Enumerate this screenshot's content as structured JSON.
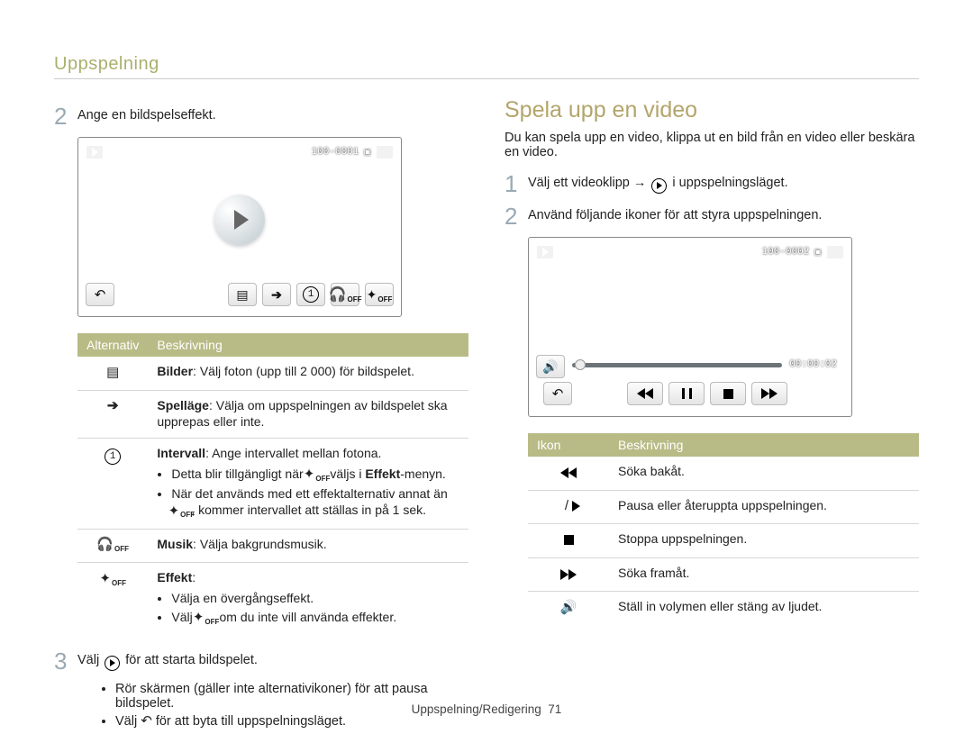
{
  "doc": {
    "header": "Uppspelning",
    "footer_label": "Uppspelning/Redigering",
    "footer_page": "71"
  },
  "left": {
    "steps": {
      "s2": {
        "num": "2",
        "text": "Ange en bildspelseffekt."
      },
      "s3": {
        "num": "3",
        "prefix": "Välj ",
        "suffix": " för att starta bildspelet.",
        "bullets": [
          "Rör skärmen (gäller inte alternativikoner) för att pausa bildspelet.",
          {
            "pre": "Välj ",
            "icon": "↶",
            "post": " för att byta till uppspelningsläget."
          }
        ]
      }
    },
    "screen": {
      "corner_id": "100-0001",
      "icons": {
        "back": "↶",
        "images": "images-icon",
        "arrow": "➔",
        "interval": "1",
        "music_off": "OFF",
        "effect_off": "OFF"
      }
    },
    "table": {
      "headers": {
        "c1": "Alternativ",
        "c2": "Beskrivning"
      },
      "rows": {
        "images": {
          "b": "Bilder",
          "rest": ": Välj foton (upp till 2 000) för bildspelet."
        },
        "playmode": {
          "b": "Spelläge",
          "rest": ": Välja om uppspelningen av bildspelet ska upprepas eller inte."
        },
        "interval": {
          "b": "Intervall",
          "rest": ": Ange intervallet mellan fotona.",
          "b1": {
            "pre": "Detta blir tillgängligt när ",
            "mid": " väljs i ",
            "bold": "Effekt",
            "post": "-menyn."
          },
          "b2": {
            "pre": "När det används med ett effektalternativ annat än ",
            "post": ", kommer intervallet att ställas in på 1 sek."
          }
        },
        "music": {
          "b": "Musik",
          "rest": ": Välja bakgrundsmusik."
        },
        "effect": {
          "b": "Effekt",
          "rest": ":",
          "b1": "Välja en övergångseffekt.",
          "b2": {
            "pre": "Välj ",
            "post": " om du inte vill använda effekter."
          }
        }
      }
    }
  },
  "right": {
    "title": "Spela upp en video",
    "intro": "Du kan spela upp en video, klippa ut en bild från en video eller beskära en video.",
    "steps": {
      "s1": {
        "num": "1",
        "pre": "Välj ett videoklipp → ",
        "post": " i uppspelningsläget."
      },
      "s2": {
        "num": "2",
        "text": "Använd följande ikoner för att styra uppspelningen."
      }
    },
    "screen": {
      "corner_id": "100-0002",
      "time": "00:00:02"
    },
    "table": {
      "headers": {
        "c1": "Ikon",
        "c2": "Beskrivning"
      },
      "rows": {
        "rw": "Söka bakåt.",
        "pp": "Pausa eller återuppta uppspelningen.",
        "stop": "Stoppa uppspelningen.",
        "ff": "Söka framåt.",
        "vol": "Ställ in volymen eller stäng av ljudet."
      }
    }
  }
}
